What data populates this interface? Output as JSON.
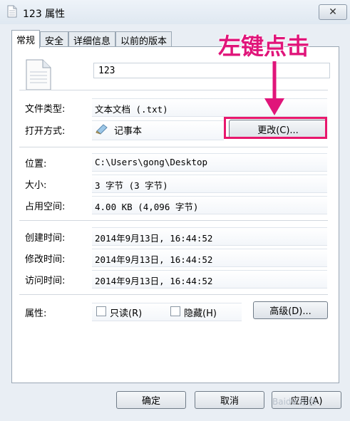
{
  "window": {
    "title": "123 属性",
    "close_glyph": "✕"
  },
  "tabs": [
    {
      "label": "常规",
      "active": true
    },
    {
      "label": "安全",
      "active": false
    },
    {
      "label": "详细信息",
      "active": false
    },
    {
      "label": "以前的版本",
      "active": false
    }
  ],
  "general": {
    "file_name": "123",
    "file_type_label": "文件类型:",
    "file_type_value": "文本文档 (.txt)",
    "opens_with_label": "打开方式:",
    "opens_with_value": "记事本",
    "change_button": "更改(C)...",
    "location_label": "位置:",
    "location_value": "C:\\Users\\gong\\Desktop",
    "size_label": "大小:",
    "size_value": "3 字节 (3 字节)",
    "size_on_disk_label": "占用空间:",
    "size_on_disk_value": "4.00 KB (4,096 字节)",
    "created_label": "创建时间:",
    "created_value": "2014年9月13日, 16:44:52",
    "modified_label": "修改时间:",
    "modified_value": "2014年9月13日, 16:44:52",
    "accessed_label": "访问时间:",
    "accessed_value": "2014年9月13日, 16:44:52",
    "attributes_label": "属性:",
    "readonly_label": "只读(R)",
    "hidden_label": "隐藏(H)",
    "advanced_button": "高级(D)..."
  },
  "footer": {
    "ok": "确定",
    "cancel": "取消",
    "apply": "应用(A)"
  },
  "annotation": {
    "text": "左键点击",
    "color": "#e0157a"
  },
  "watermark": "Baidu 经验"
}
